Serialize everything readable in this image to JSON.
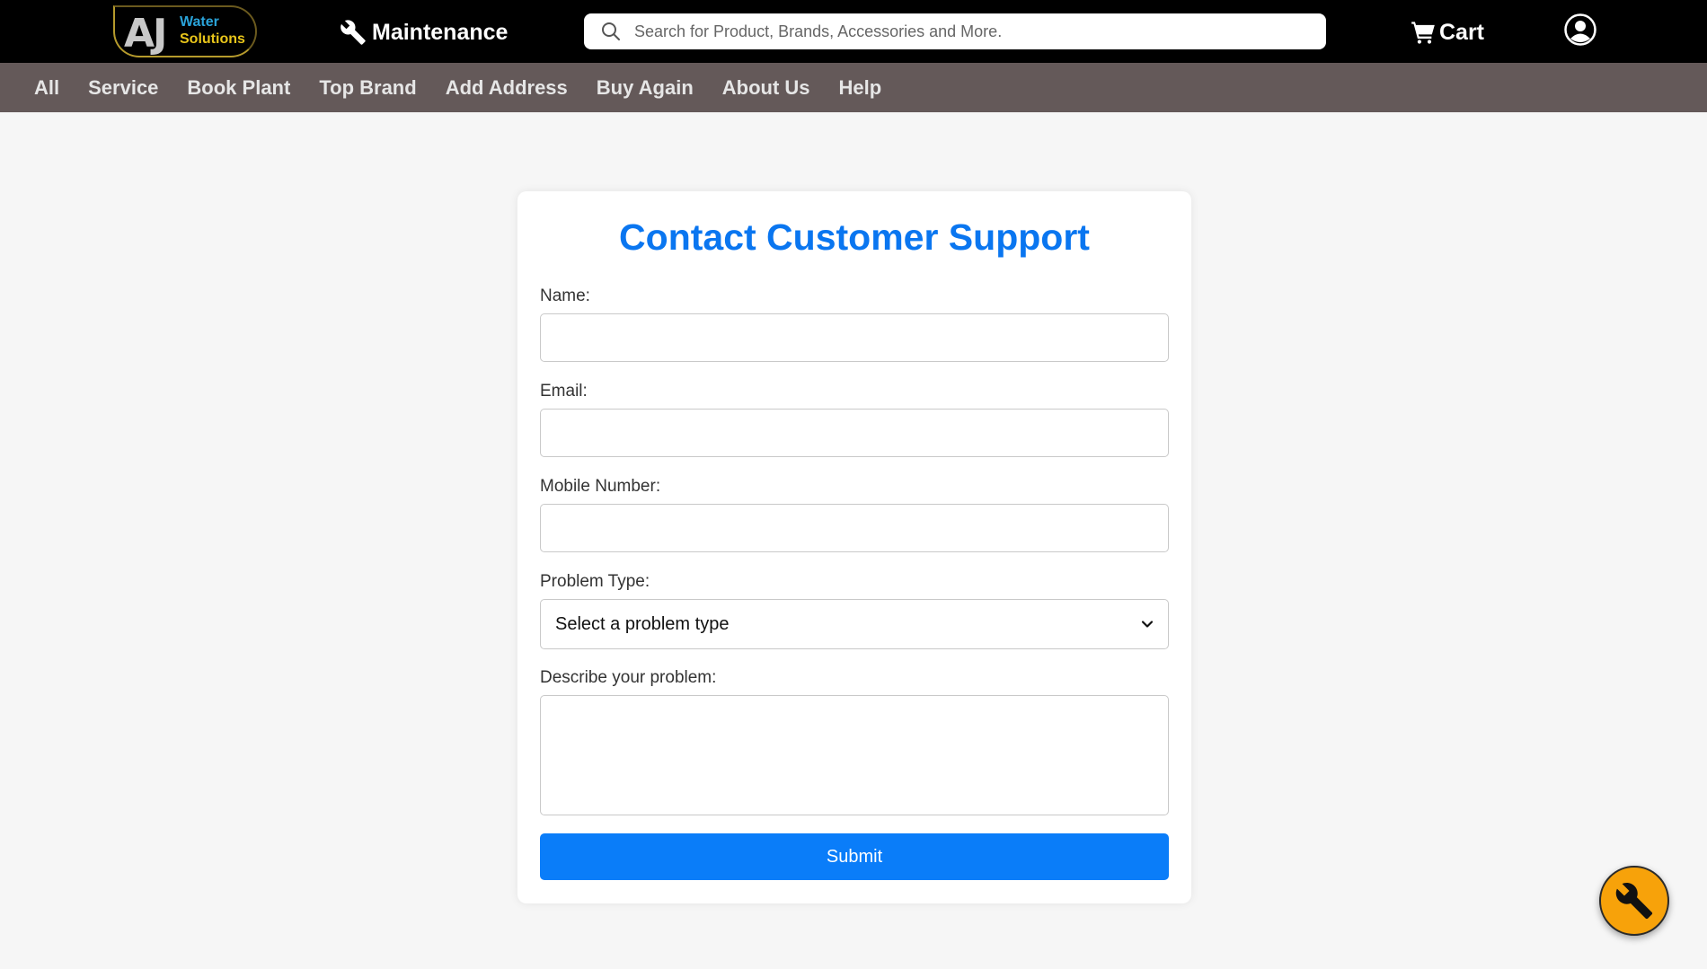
{
  "header": {
    "logo": {
      "main": "AJ",
      "line1": "Water",
      "line2": "Solutions"
    },
    "maintenance_label": "Maintenance",
    "search": {
      "placeholder": "Search for Product, Brands, Accessories and More.",
      "value": ""
    },
    "cart_label": "Cart"
  },
  "nav": {
    "items": [
      "All",
      "Service",
      "Book Plant",
      "Top Brand",
      "Add Address",
      "Buy Again",
      "About Us",
      "Help"
    ]
  },
  "form": {
    "title": "Contact Customer Support",
    "name_label": "Name:",
    "name_value": "",
    "email_label": "Email:",
    "email_value": "",
    "mobile_label": "Mobile Number:",
    "mobile_value": "",
    "problem_type_label": "Problem Type:",
    "problem_type_selected": "Select a problem type",
    "description_label": "Describe your problem:",
    "description_value": "",
    "submit_label": "Submit"
  },
  "colors": {
    "topbar": "#000000",
    "navbar": "#645959",
    "accent": "#0a7df9",
    "title": "#0a76f0",
    "fab": "#f7a20a"
  },
  "icons": {
    "maintenance": "wrench-icon",
    "search": "search-icon",
    "cart": "cart-icon",
    "account": "user-circle-icon",
    "select": "chevron-down-icon",
    "fab": "wrench-icon"
  }
}
